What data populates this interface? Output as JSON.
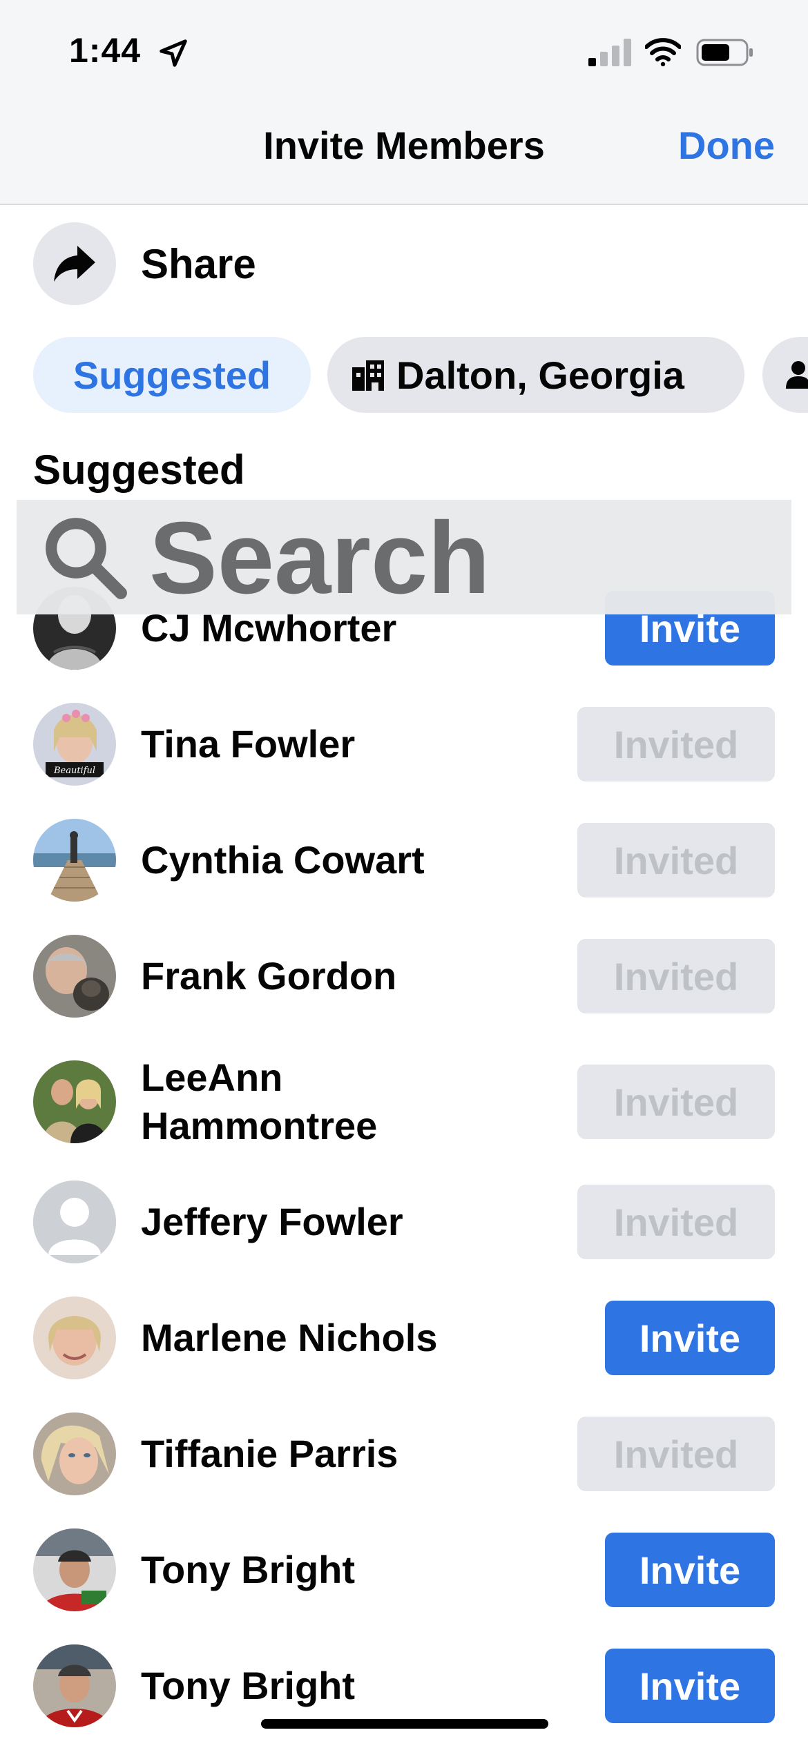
{
  "status_bar": {
    "time": "1:44"
  },
  "header": {
    "title": "Invite Members",
    "done_label": "Done"
  },
  "share": {
    "label": "Share"
  },
  "chips": {
    "suggested": "Suggested",
    "location": "Dalton, Georgia"
  },
  "section_title": "Suggested",
  "search": {
    "placeholder": "Search"
  },
  "members": [
    {
      "name": "CJ Mcwhorter",
      "button": "Invite",
      "state": "invite"
    },
    {
      "name": "Tina Fowler",
      "button": "Invited",
      "state": "invited"
    },
    {
      "name": "Cynthia Cowart",
      "button": "Invited",
      "state": "invited"
    },
    {
      "name": "Frank Gordon",
      "button": "Invited",
      "state": "invited"
    },
    {
      "name": "LeeAnn Hammontree",
      "button": "Invited",
      "state": "invited"
    },
    {
      "name": "Jeffery Fowler",
      "button": "Invited",
      "state": "invited"
    },
    {
      "name": "Marlene Nichols",
      "button": "Invite",
      "state": "invite"
    },
    {
      "name": "Tiffanie Parris",
      "button": "Invited",
      "state": "invited"
    },
    {
      "name": "Tony Bright",
      "button": "Invite",
      "state": "invite"
    },
    {
      "name": "Tony Bright",
      "button": "Invite",
      "state": "invite"
    }
  ],
  "colors": {
    "accent": "#2e74e3",
    "chip_active_bg": "#e7f0fd",
    "invited_bg": "#e4e6eb",
    "invited_text": "#bec1c6"
  }
}
